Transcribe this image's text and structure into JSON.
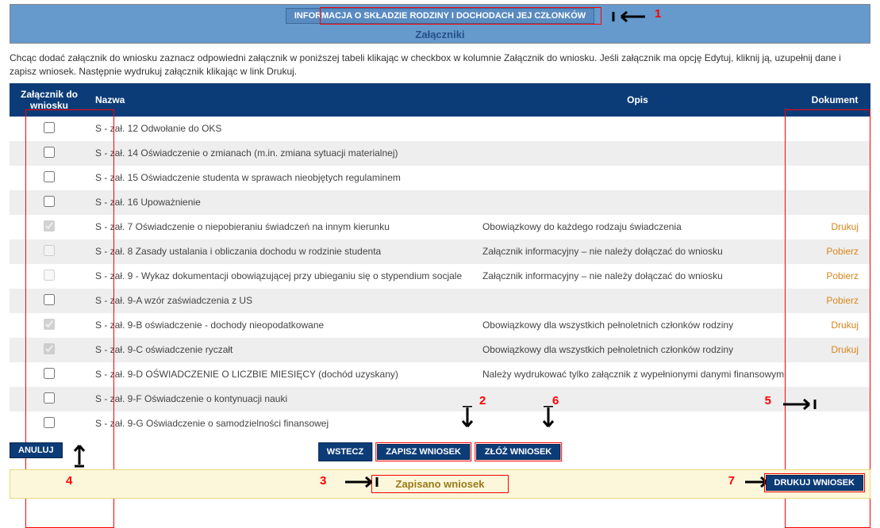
{
  "banner": {
    "info_button": "INFORMACJA O SKŁADZIE RODZINY I DOCHODACH JEJ CZŁONKÓW",
    "zalaczniki": "Załączniki"
  },
  "intro": "Chcąc dodać załącznik do wniosku zaznacz odpowiedni załącznik w poniższej tabeli klikając w checkbox w kolumnie Załącznik do wniosku. Jeśli załącznik ma opcję Edytuj, kliknij ją, uzupełnij dane i zapisz wniosek. Następnie wydrukuj załącznik klikając w link Drukuj.",
  "columns": {
    "zalacznik": "Załącznik do wniosku",
    "nazwa": "Nazwa",
    "opis": "Opis",
    "dokument": "Dokument"
  },
  "rows": [
    {
      "checked": false,
      "disabled": false,
      "nazwa": "S - zał. 12 Odwołanie do OKS",
      "opis": "",
      "dok": ""
    },
    {
      "checked": false,
      "disabled": false,
      "nazwa": "S - zał. 14 Oświadczenie o zmianach (m.in. zmiana sytuacji materialnej)",
      "opis": "",
      "dok": ""
    },
    {
      "checked": false,
      "disabled": false,
      "nazwa": "S - zał. 15 Oświadczenie studenta w sprawach nieobjętych regulaminem",
      "opis": "",
      "dok": ""
    },
    {
      "checked": false,
      "disabled": false,
      "nazwa": "S - zał. 16 Upoważnienie",
      "opis": "",
      "dok": ""
    },
    {
      "checked": true,
      "disabled": true,
      "nazwa": "S - zał. 7 Oświadczenie o niepobieraniu świadczeń na innym kierunku",
      "opis": "Obowiązkowy do każdego rodzaju świadczenia",
      "dok": "Drukuj"
    },
    {
      "checked": false,
      "disabled": true,
      "nazwa": "S - zał. 8 Zasady ustalania i obliczania dochodu w rodzinie studenta",
      "opis": "Załącznik informacyjny – nie należy dołączać do wniosku",
      "dok": "Pobierz"
    },
    {
      "checked": false,
      "disabled": true,
      "nazwa": "S - zał. 9 - Wykaz dokumentacji obowiązującej przy ubieganiu się o stypendium socjale",
      "opis": "Załącznik informacyjny – nie należy dołączać do wniosku",
      "dok": "Pobierz"
    },
    {
      "checked": false,
      "disabled": false,
      "nazwa": "S - zał. 9-A wzór zaświadczenia z US",
      "opis": "",
      "dok": "Pobierz"
    },
    {
      "checked": true,
      "disabled": true,
      "nazwa": "S - zał. 9-B oświadczenie - dochody nieopodatkowane",
      "opis": "Obowiązkowy dla wszystkich pełnoletnich członków rodziny",
      "dok": "Drukuj"
    },
    {
      "checked": true,
      "disabled": true,
      "nazwa": "S - zał. 9-C oświadczenie ryczałt",
      "opis": "Obowiązkowy dla wszystkich pełnoletnich członków rodziny",
      "dok": "Drukuj"
    },
    {
      "checked": false,
      "disabled": false,
      "nazwa": "S - zał. 9-D OŚWIADCZENIE O LICZBIE MIESIĘCY (dochód uzyskany)",
      "opis": "Należy wydrukować tylko załącznik z wypełnionymi danymi finansowymi",
      "dok": ""
    },
    {
      "checked": false,
      "disabled": false,
      "nazwa": "S - zał. 9-F Oświadczenie o kontynuacji nauki",
      "opis": "",
      "dok": ""
    },
    {
      "checked": false,
      "disabled": false,
      "nazwa": "S - zał. 9-G Oświadczenie o samodzielności finansowej",
      "opis": "",
      "dok": ""
    }
  ],
  "buttons": {
    "anuluj": "ANULUJ",
    "wstecz": "WSTECZ",
    "zapisz": "ZAPISZ WNIOSEK",
    "zloz": "ZŁÓŻ WNIOSEK",
    "drukuj": "DRUKUJ WNIOSEK"
  },
  "message": "Zapisano wniosek",
  "annotations": {
    "n1": "1",
    "n2": "2",
    "n3": "3",
    "n4": "4",
    "n5": "5",
    "n6": "6",
    "n7": "7"
  }
}
